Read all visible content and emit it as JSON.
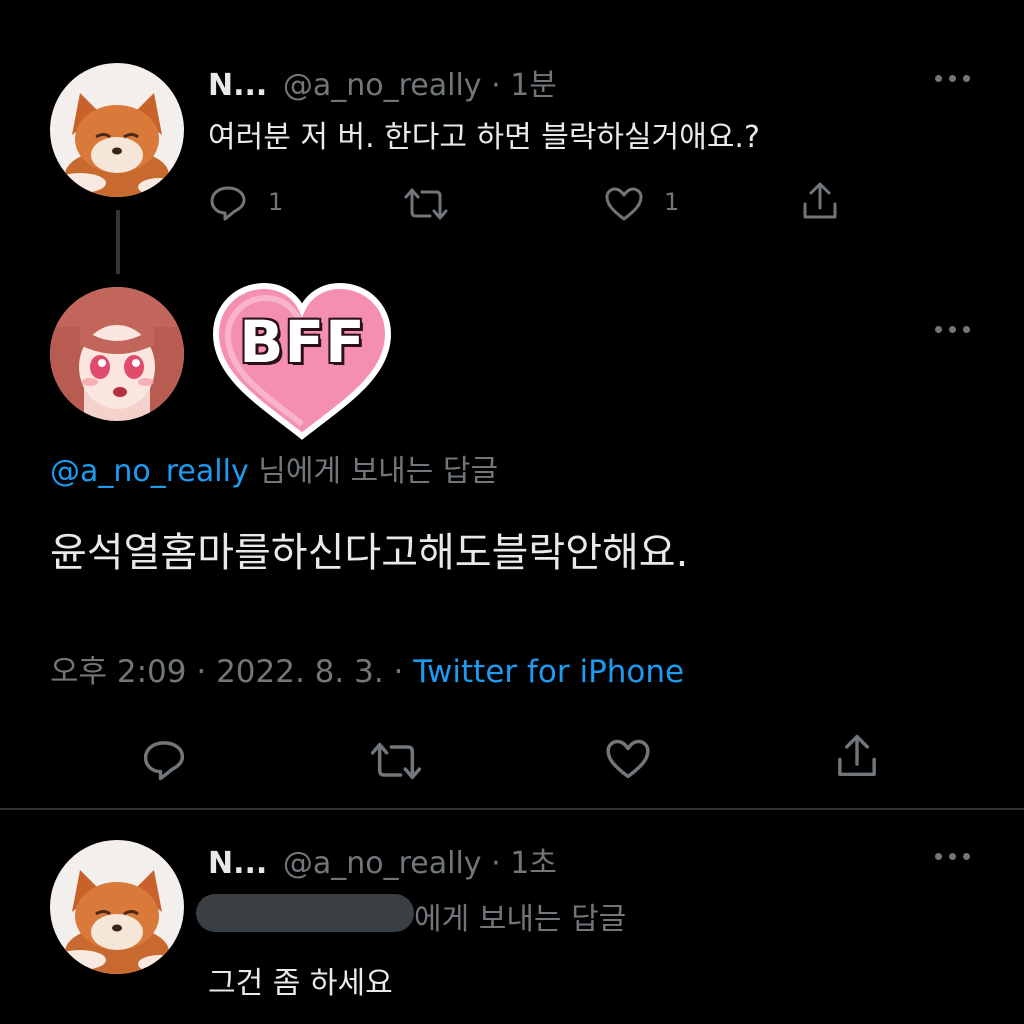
{
  "colors": {
    "background": "#000000",
    "text": "#e7e9ea",
    "secondary": "#71767b",
    "link": "#1d9bf0",
    "divider": "#2f3336"
  },
  "tweet1": {
    "display_name": "N...",
    "handle": "@a_no_really",
    "separator": "·",
    "time": "1분",
    "text": "여러분 저 버. 한다고 하면 블락하실거애요.?",
    "reply_count": "1",
    "like_count": "1",
    "icons": [
      "reply-icon",
      "retweet-icon",
      "like-icon",
      "share-icon",
      "more-icon"
    ]
  },
  "main": {
    "sticker_text": "BFF",
    "replying_to_handle": "@a_no_really",
    "replying_to_suffix": "님에게 보내는 답글",
    "text": "윤석열홈마를하신다고해도블락안해요.",
    "timestamp": "오후 2:09 · 2022. 8. 3. ·",
    "source": "Twitter for iPhone"
  },
  "tweet3": {
    "display_name": "N...",
    "handle": "@a_no_really",
    "separator": "·",
    "time": "1초",
    "replying_to_suffix": "에게 보내는 답글",
    "text": "그건 좀 하세요"
  }
}
